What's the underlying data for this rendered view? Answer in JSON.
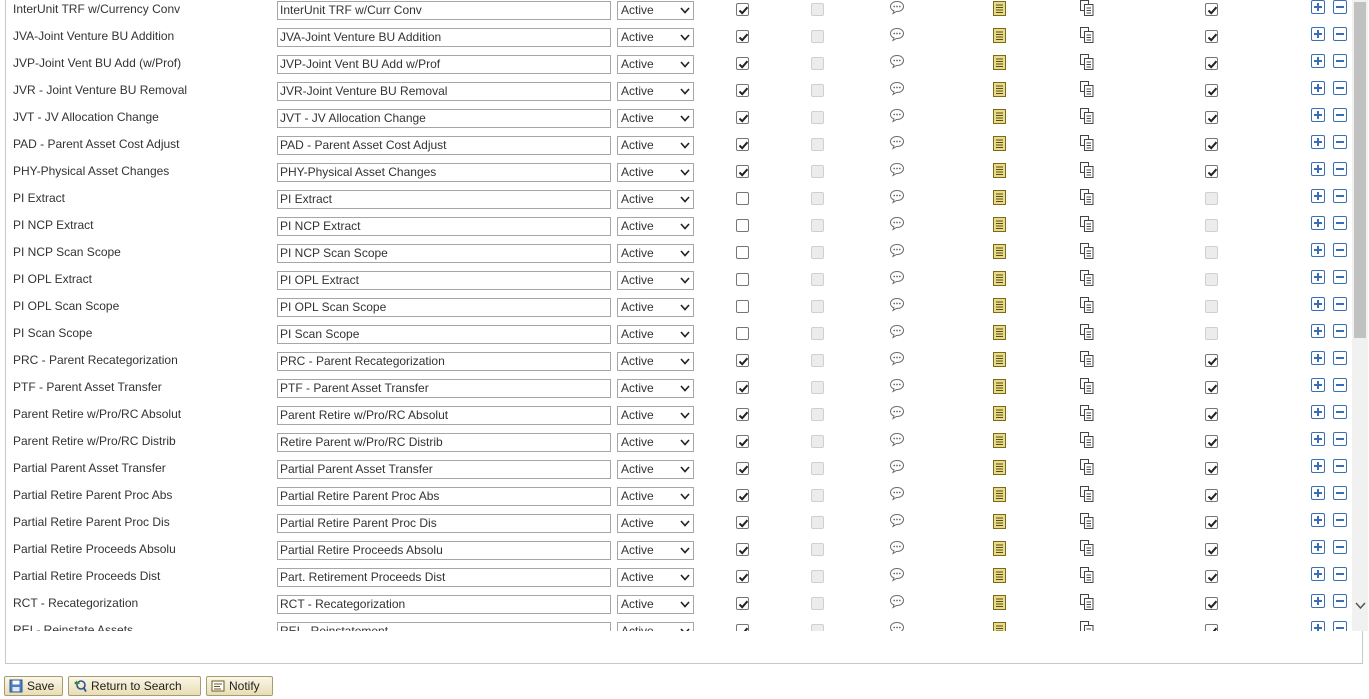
{
  "rows": [
    {
      "description": "InterUnit TRF w/Currency Conv",
      "short": "InterUnit TRF w/Curr Conv",
      "status": "Active",
      "c1": true,
      "c3": true
    },
    {
      "description": "JVA-Joint Venture BU Addition",
      "short": "JVA-Joint Venture BU Addition",
      "status": "Active",
      "c1": true,
      "c3": true
    },
    {
      "description": "JVP-Joint Vent BU Add (w/Prof)",
      "short": "JVP-Joint Vent BU Add w/Prof",
      "status": "Active",
      "c1": true,
      "c3": true
    },
    {
      "description": "JVR - Joint Venture BU Removal",
      "short": "JVR-Joint Venture BU Removal",
      "status": "Active",
      "c1": true,
      "c3": true
    },
    {
      "description": "JVT - JV Allocation Change",
      "short": "JVT - JV Allocation Change",
      "status": "Active",
      "c1": true,
      "c3": true
    },
    {
      "description": "PAD - Parent Asset Cost Adjust",
      "short": "PAD - Parent Asset Cost Adjust",
      "status": "Active",
      "c1": true,
      "c3": true
    },
    {
      "description": "PHY-Physical Asset Changes",
      "short": "PHY-Physical Asset Changes",
      "status": "Active",
      "c1": true,
      "c3": true
    },
    {
      "description": "PI Extract",
      "short": "PI Extract",
      "status": "Active",
      "c1": false,
      "c3": false
    },
    {
      "description": "PI NCP Extract",
      "short": "PI NCP Extract",
      "status": "Active",
      "c1": false,
      "c3": false
    },
    {
      "description": "PI NCP Scan Scope",
      "short": "PI NCP Scan Scope",
      "status": "Active",
      "c1": false,
      "c3": false
    },
    {
      "description": "PI OPL Extract",
      "short": "PI OPL Extract",
      "status": "Active",
      "c1": false,
      "c3": false
    },
    {
      "description": "PI OPL Scan Scope",
      "short": "PI OPL Scan Scope",
      "status": "Active",
      "c1": false,
      "c3": false
    },
    {
      "description": "PI Scan Scope",
      "short": "PI Scan Scope",
      "status": "Active",
      "c1": false,
      "c3": false
    },
    {
      "description": "PRC - Parent Recategorization",
      "short": "PRC - Parent Recategorization",
      "status": "Active",
      "c1": true,
      "c3": true
    },
    {
      "description": "PTF - Parent Asset Transfer",
      "short": "PTF - Parent Asset Transfer",
      "status": "Active",
      "c1": true,
      "c3": true
    },
    {
      "description": "Parent Retire w/Pro/RC Absolut",
      "short": "Parent Retire w/Pro/RC Absolut",
      "status": "Active",
      "c1": true,
      "c3": true
    },
    {
      "description": "Parent Retire w/Pro/RC Distrib",
      "short": "Retire Parent w/Pro/RC Distrib",
      "status": "Active",
      "c1": true,
      "c3": true
    },
    {
      "description": "Partial Parent Asset Transfer",
      "short": "Partial Parent Asset Transfer",
      "status": "Active",
      "c1": true,
      "c3": true
    },
    {
      "description": "Partial Retire Parent Proc Abs",
      "short": "Partial Retire Parent Proc Abs",
      "status": "Active",
      "c1": true,
      "c3": true
    },
    {
      "description": "Partial Retire Parent Proc Dis",
      "short": "Partial Retire Parent Proc Dis",
      "status": "Active",
      "c1": true,
      "c3": true
    },
    {
      "description": "Partial Retire Proceeds Absolu",
      "short": "Partial Retire Proceeds Absolu",
      "status": "Active",
      "c1": true,
      "c3": true
    },
    {
      "description": "Partial Retire Proceeds Dist",
      "short": "Part. Retirement Proceeds Dist",
      "status": "Active",
      "c1": true,
      "c3": true
    },
    {
      "description": "RCT - Recategorization",
      "short": "RCT - Recategorization",
      "status": "Active",
      "c1": true,
      "c3": true
    },
    {
      "description": "REI - Reinstate Assets",
      "short": "REI - Reinstatement",
      "status": "Active",
      "c1": true,
      "c3": true
    }
  ],
  "toolbar": {
    "save_label": "Save",
    "return_label": "Return to Search",
    "notify_label": "Notify"
  },
  "icons": {
    "comment": "comment-bubble-icon",
    "detail": "detail-page-icon",
    "copy": "copy-icon",
    "add": "add-row-icon",
    "delete": "delete-row-icon"
  },
  "colors": {
    "detail_icon": "#c9b53a",
    "add_delete_icon": "#3a6eb5",
    "button_border": "#a99c71"
  }
}
